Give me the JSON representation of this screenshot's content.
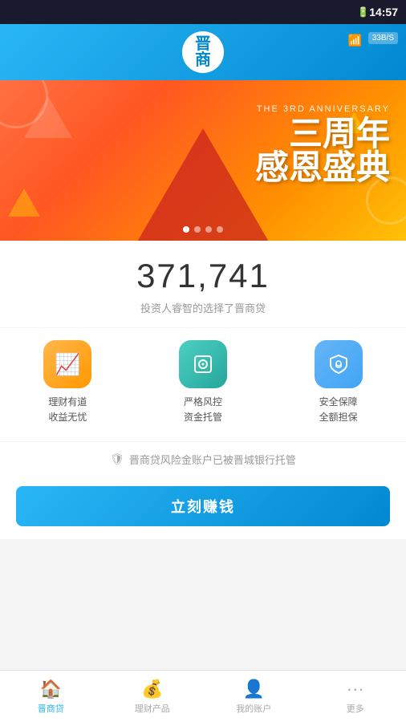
{
  "statusBar": {
    "time": "14:57",
    "battery": "🔋",
    "network": "33B/S"
  },
  "header": {
    "logoText": "晋\n商\n贷",
    "wifiIcon": "📶"
  },
  "banner": {
    "subtitle": "THE 3RD ANNIVERSARY",
    "titleLine1": "三周年",
    "titleLine2": "感恩盛典",
    "dots": [
      true,
      false,
      false,
      false
    ]
  },
  "stats": {
    "number": "371,741",
    "subtitle": "投资人睿智的选择了晋商贷"
  },
  "features": [
    {
      "iconSymbol": "📈",
      "label": "理财有道\n收益无忧",
      "colorClass": "orange"
    },
    {
      "iconSymbol": "🔐",
      "label": "严格风控\n资金托管",
      "colorClass": "teal"
    },
    {
      "iconSymbol": "🔒",
      "label": "安全保障\n全额担保",
      "colorClass": "blue"
    }
  ],
  "trustBadge": {
    "icon": "🛡",
    "text": "晋商贷风险金账户已被晋城银行托管"
  },
  "cta": {
    "buttonLabel": "立刻赚钱"
  },
  "bottomNav": [
    {
      "id": "home",
      "icon": "🏠",
      "label": "晋商贷",
      "active": true
    },
    {
      "id": "products",
      "icon": "💰",
      "label": "理财产品",
      "active": false
    },
    {
      "id": "account",
      "icon": "👤",
      "label": "我的账户",
      "active": false
    },
    {
      "id": "more",
      "icon": "···",
      "label": "更多",
      "active": false
    }
  ]
}
